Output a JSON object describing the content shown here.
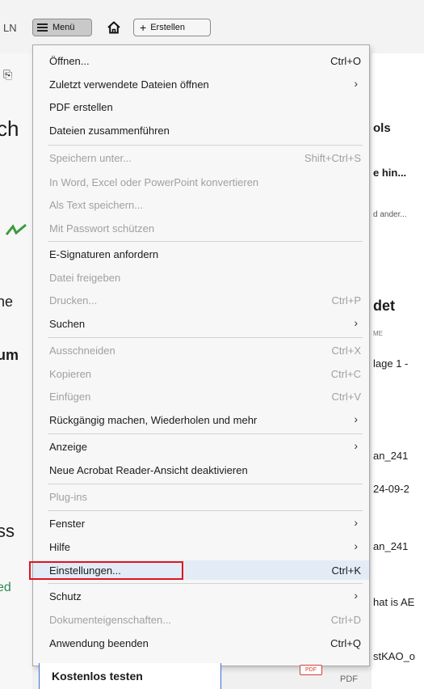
{
  "toolbar": {
    "edge_text": "LN",
    "menu_label": "Menü",
    "create_label": "Erstellen"
  },
  "background": {
    "left": [
      "ch",
      "ne",
      "um",
      "ss",
      "ed"
    ],
    "right": [
      "ols",
      "e hin...",
      "d ander...",
      "det",
      "ME",
      "lage 1 -",
      "an_241",
      "24-09-2",
      "an_241",
      "hat is AE",
      "stKAO_o"
    ]
  },
  "menu": {
    "items": [
      {
        "label": "Öffnen...",
        "shortcut": "Ctrl+O"
      },
      {
        "label": "Zuletzt verwendete Dateien öffnen",
        "arrow": "›"
      },
      {
        "label": "PDF erstellen"
      },
      {
        "label": "Dateien zusammenführen"
      },
      {
        "label": "Speichern unter...",
        "shortcut": "Shift+Ctrl+S"
      },
      {
        "label": "In Word, Excel oder PowerPoint konvertieren"
      },
      {
        "label": "Als Text speichern..."
      },
      {
        "label": "Mit Passwort schützen"
      },
      {
        "label": "E-Signaturen anfordern"
      },
      {
        "label": "Datei freigeben"
      },
      {
        "label": "Drucken...",
        "shortcut": "Ctrl+P"
      },
      {
        "label": "Suchen",
        "arrow": "›"
      },
      {
        "label": "Ausschneiden",
        "shortcut": "Ctrl+X"
      },
      {
        "label": "Kopieren",
        "shortcut": "Ctrl+C"
      },
      {
        "label": "Einfügen",
        "shortcut": "Ctrl+V"
      },
      {
        "label": "Rückgängig machen, Wiederholen und mehr",
        "arrow": "›"
      },
      {
        "label": "Anzeige",
        "arrow": "›"
      },
      {
        "label": "Neue Acrobat Reader-Ansicht deaktivieren"
      },
      {
        "label": "Plug-ins"
      },
      {
        "label": "Fenster",
        "arrow": "›"
      },
      {
        "label": "Hilfe",
        "arrow": "›"
      },
      {
        "label": "Einstellungen...",
        "shortcut": "Ctrl+K"
      },
      {
        "label": "Schutz",
        "arrow": "›"
      },
      {
        "label": "Dokumenteigenschaften...",
        "shortcut": "Ctrl+D"
      },
      {
        "label": "Anwendung beenden",
        "shortcut": "Ctrl+Q"
      }
    ]
  },
  "bottom": {
    "trial_label": "Kostenlos testen",
    "pdf_badge": "PDF",
    "pdf_type": "PDF"
  },
  "colors": {
    "highlight_row": "#e3ecf6",
    "annotation_box": "#e0141e",
    "disabled_text": "#a0a0a0"
  }
}
